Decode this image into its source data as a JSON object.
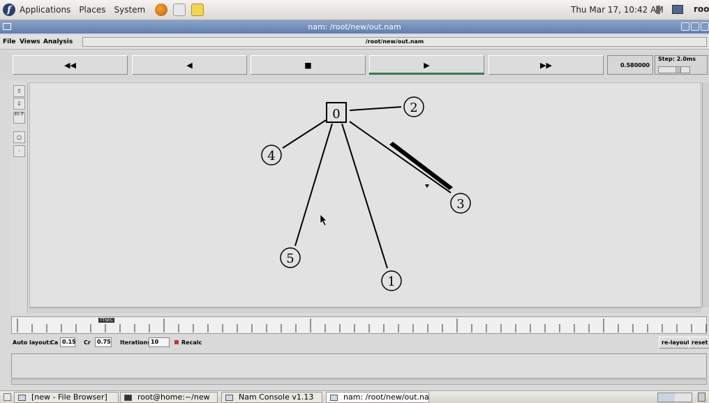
{
  "top_panel": {
    "menus": [
      "Applications",
      "Places",
      "System"
    ],
    "clock": "Thu Mar 17, 10:42 AM",
    "user": "root"
  },
  "window": {
    "title": "nam: /root/new/out.nam"
  },
  "menubar": {
    "file": "File",
    "views": "Views",
    "analysis": "Analysis",
    "path": "/root/new/out.nam"
  },
  "controls": {
    "rewind": "◀◀",
    "back": "◀",
    "stop": "■",
    "play": "▶",
    "fast_forward": "▶▶",
    "time": "0.580000",
    "step_label": "Step: 2.0ms"
  },
  "tools": {
    "edit": "ED IT"
  },
  "network": {
    "nodes": [
      "0",
      "1",
      "2",
      "3",
      "4",
      "5"
    ],
    "label_color": "#000000"
  },
  "ruler": {
    "tag": "TTSEC"
  },
  "layout": {
    "auto_label": "Auto layout:",
    "ca_label": "Ca",
    "ca_value": "0.15",
    "cr_label": "Cr",
    "cr_value": "0.75",
    "iterations_label": "Iterations",
    "iterations_value": "10",
    "recalc_label": "Recalc",
    "relayout": "re-layout",
    "reset": "reset"
  },
  "taskbar": {
    "items": [
      "[new - File Browser]",
      "root@home:~/new",
      "Nam Console v1.13",
      "nam: /root/new/out.nam"
    ]
  },
  "colors": {
    "title_bar": "#6f8cbb",
    "play_indicator": "#2f7d4a"
  }
}
